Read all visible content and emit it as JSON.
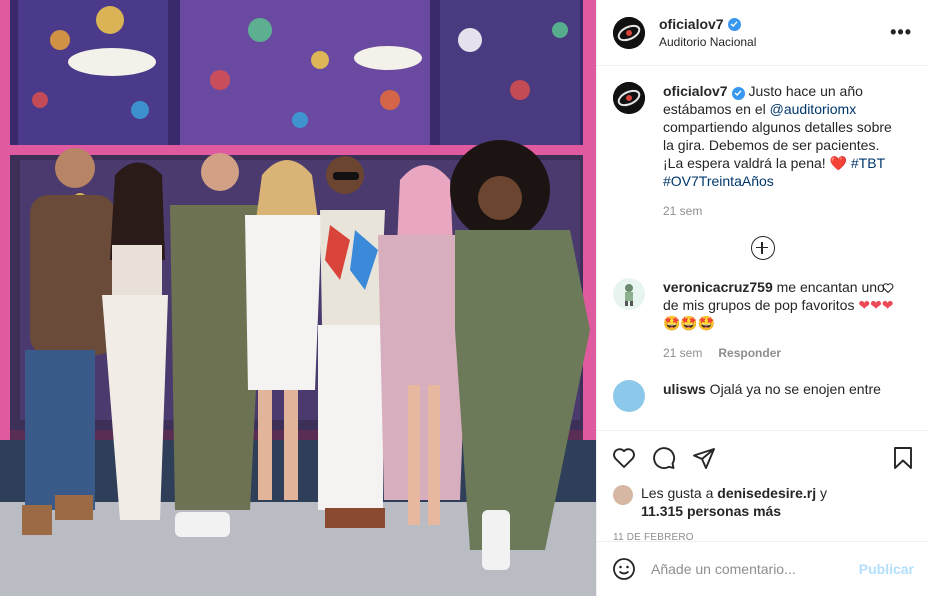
{
  "post": {
    "author": "oficialov7",
    "location": "Auditorio Nacional",
    "caption": {
      "username": "oficialov7",
      "text_1": " Justo hace un año estábamos en el ",
      "mention": "@auditoriomx",
      "text_2": " compartiendo algunos detalles sobre la gira. Debemos de ser pacientes. ¡La espera valdrá la pena! ",
      "heart": "❤️",
      "hashtag_1": "#TBT",
      "hashtag_2": "#OV7TreintaAños",
      "time": "21 sem"
    }
  },
  "comments": [
    {
      "username": "veronicacruz759",
      "text": " me encantan uno de mis grupos de pop favoritos ",
      "emojis": "❤❤❤🤩🤩🤩",
      "time": "21 sem",
      "reply_label": "Responder"
    },
    {
      "username": "ulisws",
      "text": " Ojalá ya no se enojen entre"
    }
  ],
  "likes": {
    "prefix": "Les gusta a ",
    "user": "denisedesire.rj",
    "middle": " y",
    "count": "11.315 personas más"
  },
  "date": "11 DE FEBRERO",
  "comment_box": {
    "placeholder": "Añade un comentario...",
    "publish_label": "Publicar"
  },
  "colors": {
    "verified": "#3897f0",
    "link": "#00376b",
    "muted": "#8e8e8e",
    "publish": "#b2dffc",
    "heart": "#ed4956"
  },
  "icons": [
    "more-options-icon",
    "verified-icon",
    "load-more-icon",
    "heart-icon",
    "comment-icon",
    "share-icon",
    "bookmark-icon",
    "emoji-icon"
  ]
}
